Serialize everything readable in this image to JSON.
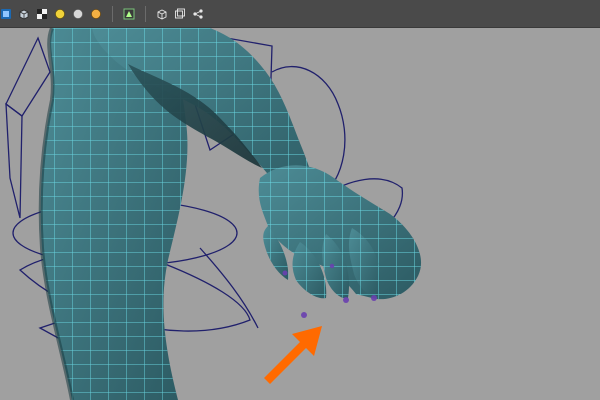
{
  "toolbar": {
    "buttons": [
      {
        "name": "camera-icon"
      },
      {
        "name": "cube-icon"
      },
      {
        "name": "checker-icon"
      },
      {
        "name": "light-yellow-icon"
      },
      {
        "name": "light-gray-icon"
      },
      {
        "name": "light-orange-icon"
      },
      {
        "name": "isolate-icon"
      },
      {
        "name": "wireframe-cube-icon"
      },
      {
        "name": "duplicate-view-icon"
      },
      {
        "name": "share-nodes-icon"
      }
    ]
  },
  "viewport": {
    "background": "#a0a0a0",
    "mesh_fill": "#3f7680",
    "mesh_shadow": "#1f3a40",
    "wire_color": "#6fe3ee",
    "rig_color": "#1a1a6a",
    "vertex_color": "#6a40b0",
    "arrow_color": "#ff6a00"
  }
}
